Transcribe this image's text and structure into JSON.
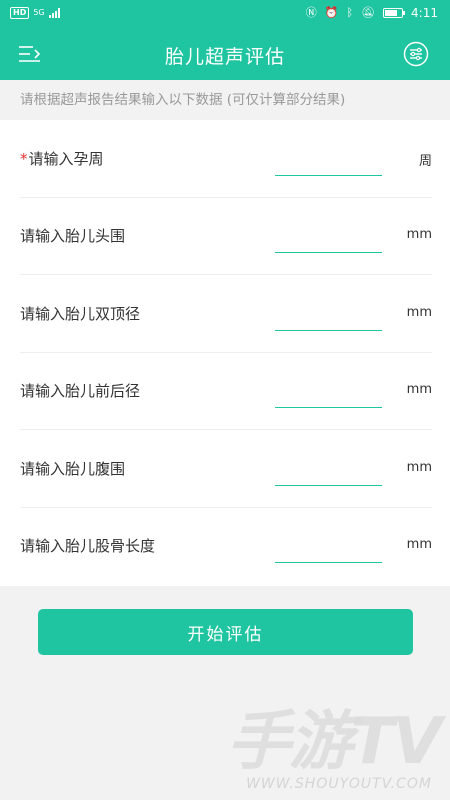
{
  "status_bar": {
    "hd": "HD",
    "network": "5G",
    "time": "4:11",
    "battery_level": 0.75
  },
  "header": {
    "title": "胎儿超声评估",
    "menu_icon": "menu-list-icon",
    "settings_icon": "sliders-settings-icon",
    "color": "#1fc4a0"
  },
  "hint": "请根据超声报告结果输入以下数据 (可仅计算部分结果)",
  "form": {
    "rows": [
      {
        "label": "请输入孕周",
        "unit": "周",
        "required": true,
        "value": ""
      },
      {
        "label": "请输入胎儿头围",
        "unit": "mm",
        "required": false,
        "value": ""
      },
      {
        "label": "请输入胎儿双顶径",
        "unit": "mm",
        "required": false,
        "value": ""
      },
      {
        "label": "请输入胎儿前后径",
        "unit": "mm",
        "required": false,
        "value": ""
      },
      {
        "label": "请输入胎儿腹围",
        "unit": "mm",
        "required": false,
        "value": ""
      },
      {
        "label": "请输入胎儿股骨长度",
        "unit": "mm",
        "required": false,
        "value": ""
      }
    ],
    "required_mark": "*"
  },
  "submit_label": "开始评估",
  "watermark": {
    "main": "手游TV",
    "sub": "WWW.SHOUYOUTV.COM"
  }
}
